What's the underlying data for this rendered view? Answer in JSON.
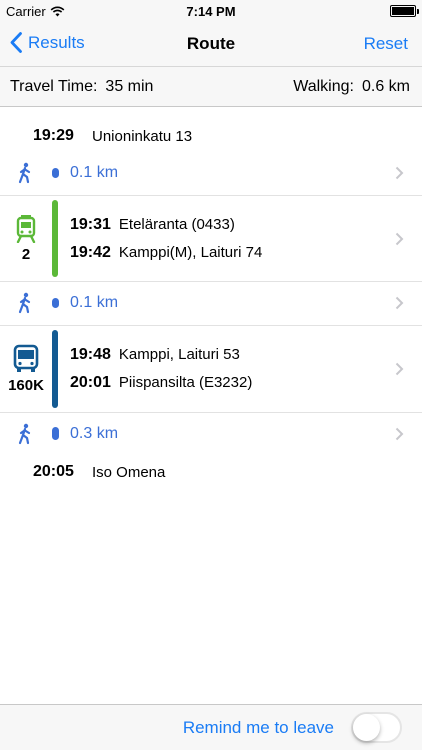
{
  "status_bar": {
    "carrier": "Carrier",
    "time": "7:14 PM",
    "wifi_icon": "wifi-icon",
    "battery_icon": "battery-icon"
  },
  "nav": {
    "back_label": "Results",
    "title": "Route",
    "reset_label": "Reset"
  },
  "summary": {
    "travel_time_label": "Travel Time:",
    "travel_time_value": "35 min",
    "walking_label": "Walking:",
    "walking_value": "0.6 km"
  },
  "route": {
    "start": {
      "time": "19:29",
      "place": "Unioninkatu 13"
    },
    "walk1": {
      "distance": "0.1 km"
    },
    "tram": {
      "line": "2",
      "icon": "tram-icon",
      "color": "#5bb838",
      "depart_time": "19:31",
      "depart_stop": "Eteläranta (0433)",
      "arrive_time": "19:42",
      "arrive_stop": "Kamppi(M), Laituri 74"
    },
    "walk2": {
      "distance": "0.1 km"
    },
    "bus": {
      "line": "160K",
      "icon": "bus-icon",
      "color": "#135a92",
      "depart_time": "19:48",
      "depart_stop": "Kamppi, Laituri 53",
      "arrive_time": "20:01",
      "arrive_stop": "Piispansilta (E3232)"
    },
    "walk3": {
      "distance": "0.3 km"
    },
    "end": {
      "time": "20:05",
      "place": "Iso Omena"
    }
  },
  "bottom": {
    "remind_label": "Remind me to leave",
    "toggle_on": false
  },
  "colors": {
    "accent": "#1a7cf5",
    "walk": "#3b6fd6"
  }
}
